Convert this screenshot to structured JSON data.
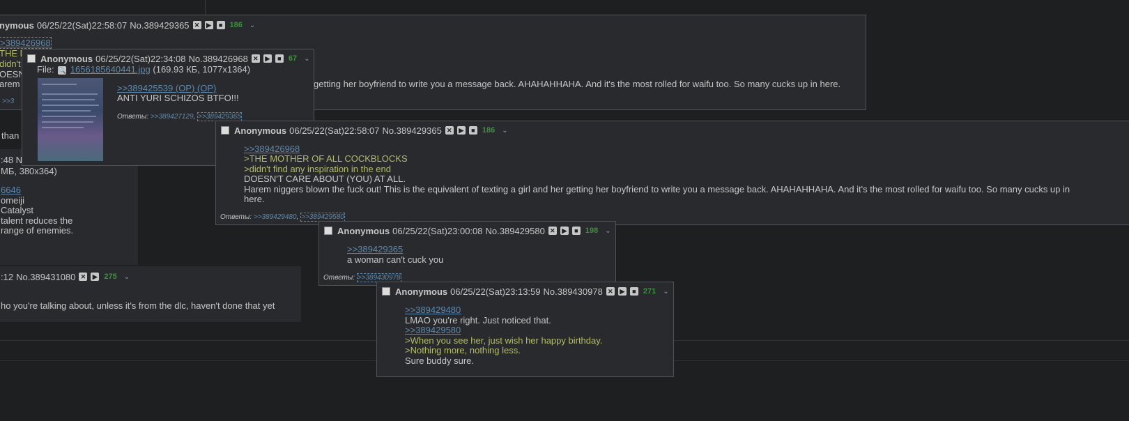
{
  "icons": {
    "hide": "x-button-icon",
    "play": "play-button-icon",
    "stop": "stop-button-icon",
    "menu": "chevron-down-icon"
  },
  "colors": {
    "background": "#1d1f21",
    "post_bg": "#282a2e",
    "border": "#4f5256",
    "quote_link": "#5f89ac",
    "greentext": "#b5bd68",
    "reply_count": "#3f8f3f",
    "text": "#c5c8c6"
  },
  "bg": {
    "top_post": {
      "name": "nymous",
      "date": "06/25/22(Sat)22:58:07",
      "no": "No.389429365",
      "count": "186",
      "quote": ">389426968",
      "fragments": [
        "THE M",
        "didn't",
        "OESN",
        "arem"
      ],
      "tail": "getting her boyfriend to write you a message back. AHAHAHHAHA. And it's the most rolled for waifu too. So many cucks up in here."
    },
    "left_small": ">>3",
    "left_than": "than",
    "left_post": {
      "header": ":48 N",
      "file": "МБ, 380x364)",
      "quote": "6646",
      "lines": [
        "omeiji",
        "Catalyst",
        "talent reduces the",
        "range of enemies."
      ]
    },
    "bottom_post": {
      "date": ":12",
      "no": "No.389431080",
      "count": "275",
      "text": "ho you're talking about, unless it's from the dlc, haven't done that yet"
    }
  },
  "pop1": {
    "name": "Anonymous",
    "date": "06/25/22(Sat)22:34:08",
    "no": "No.389426968",
    "count": "67",
    "file_label": "File:",
    "filename": "1656185640441.jpg",
    "fileinfo": "(169.93 КБ, 1077x1364)",
    "quote": ">>389425539 (OP) (OP)",
    "text": "ANTI YURI SCHIZOS BTFO!!!",
    "replies_label": "Ответы:",
    "replies": [
      ">>389427129",
      ">>389429365"
    ]
  },
  "pop2": {
    "name": "Anonymous",
    "date": "06/25/22(Sat)22:58:07",
    "no": "No.389429365",
    "count": "186",
    "quote": ">>389426968",
    "green1": ">THE MOTHER OF ALL COCKBLOCKS",
    "green2": ">didn't find any inspiration in the end",
    "line3": "DOESN'T CARE ABOUT (YOU) AT ALL.",
    "line4": "Harem niggers blown the fuck out! This is the equivalent of texting a girl and her getting her boyfriend to write you a message back. AHAHAHHAHA. And it's the most rolled for waifu too. So many cucks up in",
    "line5": "here.",
    "replies_label": "Ответы:",
    "replies": [
      ">>389429480",
      ">>389429580"
    ]
  },
  "pop3": {
    "name": "Anonymous",
    "date": "06/25/22(Sat)23:00:08",
    "no": "No.389429580",
    "count": "198",
    "quote": ">>389429365",
    "text": "a woman can't cuck you",
    "replies_label": "Ответы:",
    "replies": [
      ">>389430978"
    ]
  },
  "pop4": {
    "name": "Anonymous",
    "date": "06/25/22(Sat)23:13:59",
    "no": "No.389430978",
    "count": "271",
    "quote1": ">>389429480",
    "text1": "LMAO you're right. Just noticed that.",
    "quote2": ">>389429580",
    "green1": ">When you see her, just wish her happy birthday.",
    "green2": ">Nothing more, nothing less.",
    "text2": "Sure buddy sure."
  }
}
